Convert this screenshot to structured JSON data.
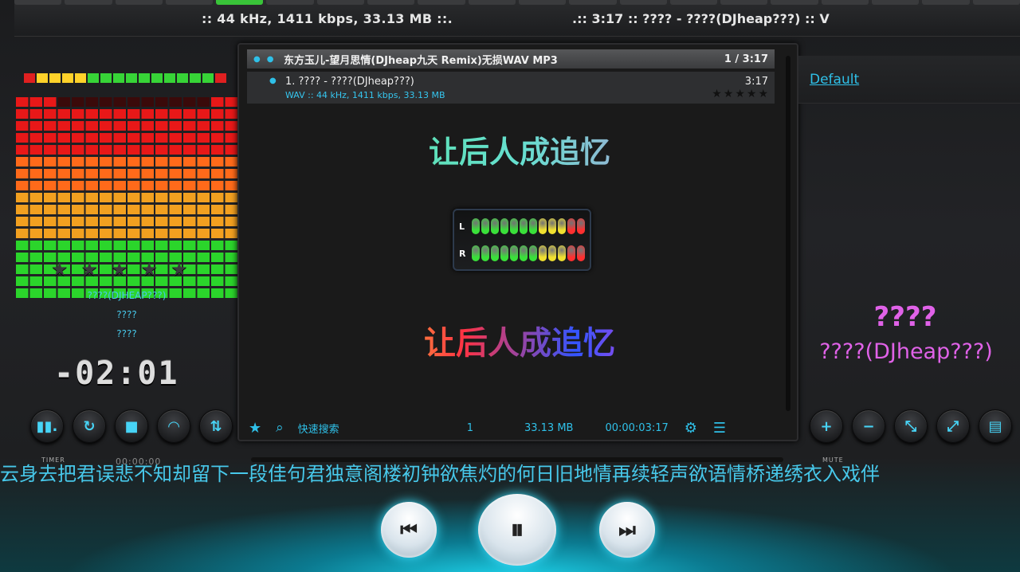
{
  "top_marquee": {
    "left_text": ":: 44 kHz, 1411 kbps, 33.13 MB ::.",
    "right_text": ".:: 3:17 :: ???? - ????(DJheap???) :: V"
  },
  "left_panel": {
    "rating_stars": 5,
    "info_artist": "????(DJHEAP???)",
    "info_line2": "????",
    "info_line3": "????",
    "time_display": "-02:01",
    "control_icons": [
      "equalizer-icon",
      "repeat-icon",
      "stop-icon",
      "wifi-icon",
      "mixer-icon"
    ],
    "control_glyphs": [
      "▮▮.",
      "↻",
      "■",
      "◠",
      "⇅"
    ]
  },
  "playlist": {
    "header_title": "东方玉儿-望月思情(DJheap九天 Remix)无损WAV MP3",
    "header_count": "1 / 3:17",
    "item_name": "1. ???? - ????(DJheap???)",
    "item_duration": "3:17",
    "item_meta": "WAV :: 44 kHz, 1411 kbps, 33.13 MB",
    "item_stars": 5,
    "lyric_line1": "让后人成追忆",
    "lyric_line2": "让后人成追忆",
    "vu_left_label": "L",
    "vu_right_label": "R",
    "vu_level_left": 1.0,
    "vu_level_right": 1.0,
    "footer": {
      "quick_search_label": "快速搜索",
      "track_count": "1",
      "total_size": "33.13 MB",
      "total_time": "00:00:03:17"
    }
  },
  "right_panel": {
    "skin_link": "Default",
    "title": "????",
    "artist": "????(DJheap???)",
    "control_icons": [
      "plus-icon",
      "minus-icon",
      "shuffle-icon",
      "resize-icon",
      "save-icon"
    ],
    "control_glyphs": [
      "+",
      "−",
      "⤡",
      "⤢",
      "▤"
    ]
  },
  "scrolling_lyric": "云身去把君误悲不知却留下一段佳句君独意阁楼初钟欲焦灼的何日旧地情再续轻声欲语情桥递绣衣入戏伴",
  "bottom_labels": {
    "timer": "TIMER",
    "timer_value": "00:00:00",
    "mute": "MUTE"
  },
  "transport": {
    "prev_glyph": "⏮",
    "pause_glyph": "⏸",
    "next_glyph": "⏭"
  },
  "colors": {
    "accent": "#2fc0e8",
    "lyric_pink": "#e062e8"
  }
}
